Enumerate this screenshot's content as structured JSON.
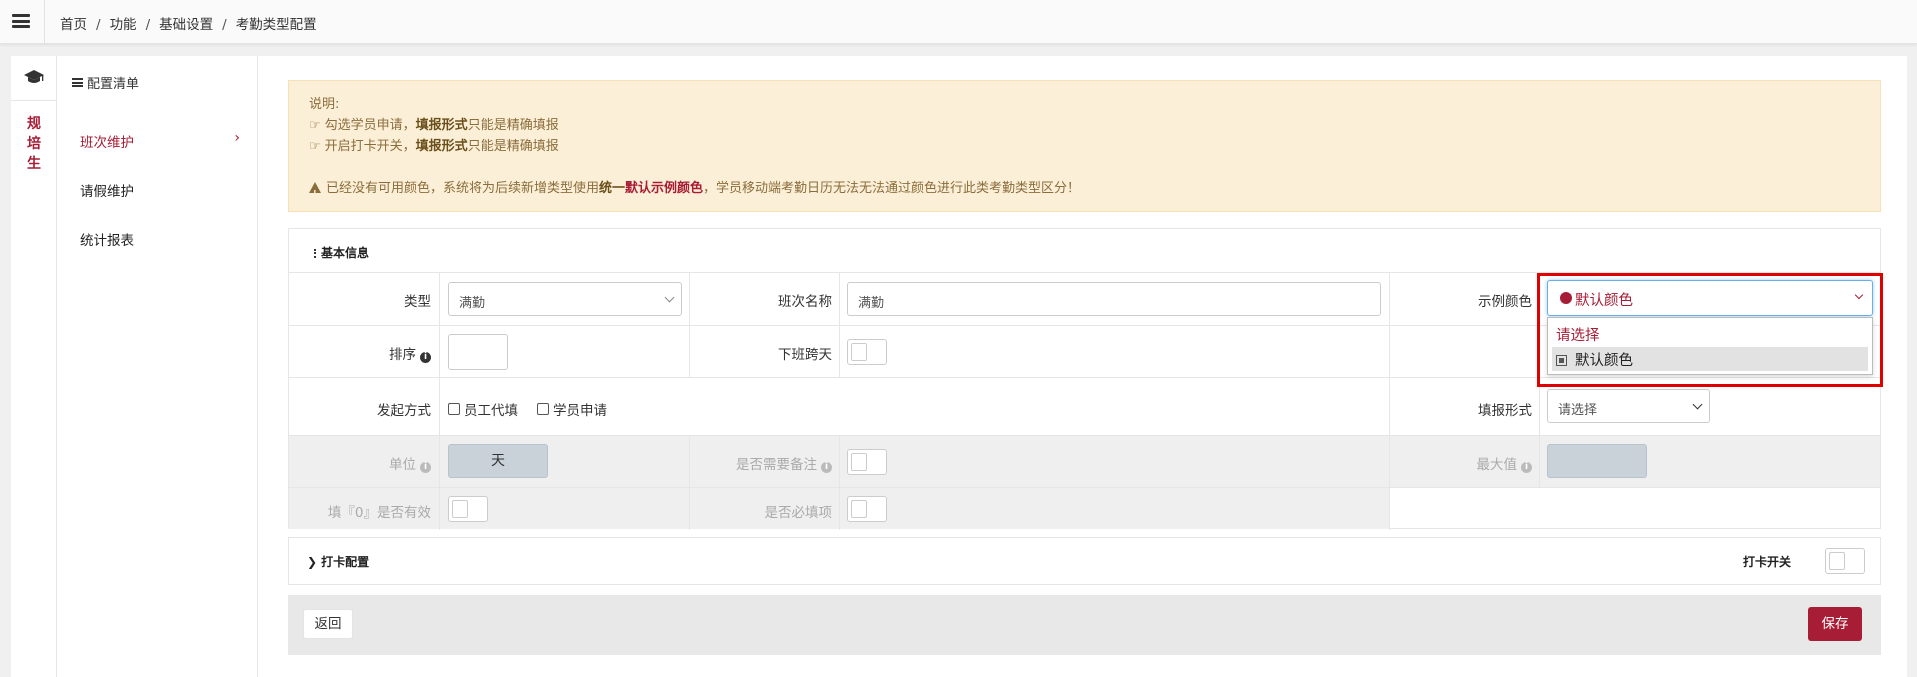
{
  "breadcrumb": [
    "首页",
    "功能",
    "基础设置",
    "考勤类型配置"
  ],
  "rail": {
    "label": "规培生"
  },
  "leftnav": {
    "title": "配置清单",
    "items": [
      {
        "label": "班次维护",
        "active": true
      },
      {
        "label": "请假维护"
      },
      {
        "label": "统计报表"
      }
    ]
  },
  "notice": {
    "heading": "说明:",
    "line1_prefix": "勾选学员申请，",
    "line1_bold": "填报形式",
    "line1_suffix": "只能是精确填报",
    "line2_prefix": "开启打卡开关，",
    "line2_bold": "填报形式",
    "line2_suffix": "只能是精确填报",
    "warn_prefix": "已经没有可用颜色，系统将为后续新增类型使用",
    "warn_bold": "统一",
    "warn_red": "默认示例颜色",
    "warn_suffix": "，学员移动端考勤日历无法无法通过颜色进行此类考勤类型区分！"
  },
  "basic": {
    "section_title": "基本信息",
    "type_label": "类型",
    "type_value": "满勤",
    "shift_name_label": "班次名称",
    "shift_name_value": "满勤",
    "color_label": "示例颜色",
    "color_value": "默认颜色",
    "color_dropdown": [
      "请选择",
      "默认颜色"
    ],
    "sort_label": "排序",
    "cross_day_label": "下班跨天",
    "initiate_label": "发起方式",
    "initiate_options": [
      "员工代填",
      "学员申请"
    ],
    "fill_form_label": "填报形式",
    "fill_form_value": "请选择",
    "unit_label": "单位",
    "unit_value": "天",
    "need_remark_label": "是否需要备注",
    "max_label": "最大值",
    "zero_valid_label": "填『0』是否有效",
    "required_label": "是否必填项"
  },
  "checkin": {
    "title": "打卡配置",
    "switch_label": "打卡开关"
  },
  "footer": {
    "back": "返回",
    "save": "保存"
  },
  "colors": {
    "brand": "#a71d36",
    "notice_bg": "#fcefd7",
    "highlight_frame": "#e00000"
  }
}
